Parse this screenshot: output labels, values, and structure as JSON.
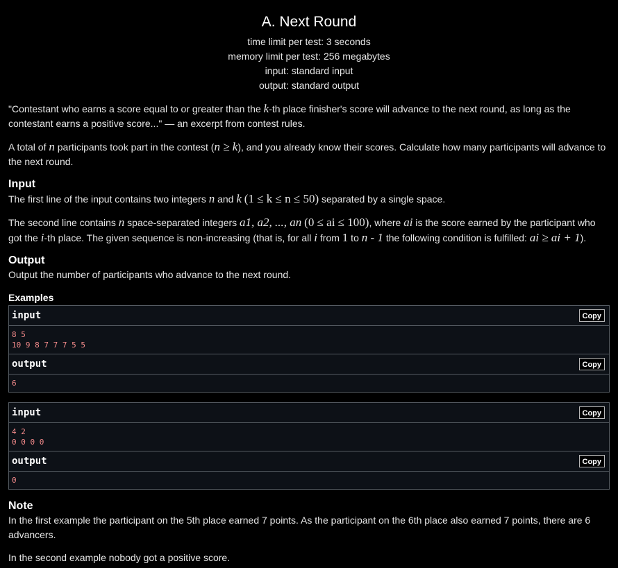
{
  "problem": {
    "title": "A. Next Round",
    "time_limit": "time limit per test: 3 seconds",
    "memory_limit": "memory limit per test: 256 megabytes",
    "input": "input: standard input",
    "output": "output: standard output"
  },
  "statement": {
    "p1_a": "\"Contestant who earns a score equal to or greater than the ",
    "p1_k": "k",
    "p1_b": "-th place finisher's score will advance to the next round, as long as the contestant earns a positive score...\" — an excerpt from contest rules.",
    "p2_a": "A total of ",
    "p2_n": "n",
    "p2_b": " participants took part in the contest (",
    "p2_cond": "n ≥ k",
    "p2_c": "), and you already know their scores. Calculate how many participants will advance to the next round."
  },
  "input_section": {
    "title": "Input",
    "l1_a": "The first line of the input contains two integers ",
    "l1_n": "n",
    "l1_and": " and ",
    "l1_k": "k",
    "l1_cond": "(1 ≤ k ≤ n ≤ 50)",
    "l1_b": " separated by a single space.",
    "l2_a": "The second line contains ",
    "l2_n": "n",
    "l2_b": " space-separated integers ",
    "l2_seq": "a1, a2, ..., an",
    "l2_cond": "(0 ≤ ai ≤ 100)",
    "l2_c": ", where ",
    "l2_ai": "ai",
    "l2_d": " is the score earned by the participant who got the ",
    "l2_i": "i",
    "l2_e": "-th place. The given sequence is non-increasing (that is, for all ",
    "l2_i2": "i",
    "l2_f": " from ",
    "l2_one": "1",
    "l2_to": " to ",
    "l2_nm1": "n - 1",
    "l2_g": " the following condition is fulfilled: ",
    "l2_ineq": "ai ≥ ai + 1",
    "l2_h": ")."
  },
  "output_section": {
    "title": "Output",
    "text": "Output the number of participants who advance to the next round."
  },
  "examples": {
    "title": "Examples",
    "copy_label": "Copy",
    "input_label": "input",
    "output_label": "output",
    "ex1_input": "8 5\n10 9 8 7 7 7 5 5",
    "ex1_output": "6",
    "ex2_input": "4 2\n0 0 0 0",
    "ex2_output": "0"
  },
  "note": {
    "title": "Note",
    "p1": "In the first example the participant on the 5th place earned 7 points. As the participant on the 6th place also earned 7 points, there are 6 advancers.",
    "p2": "In the second example nobody got a positive score."
  }
}
